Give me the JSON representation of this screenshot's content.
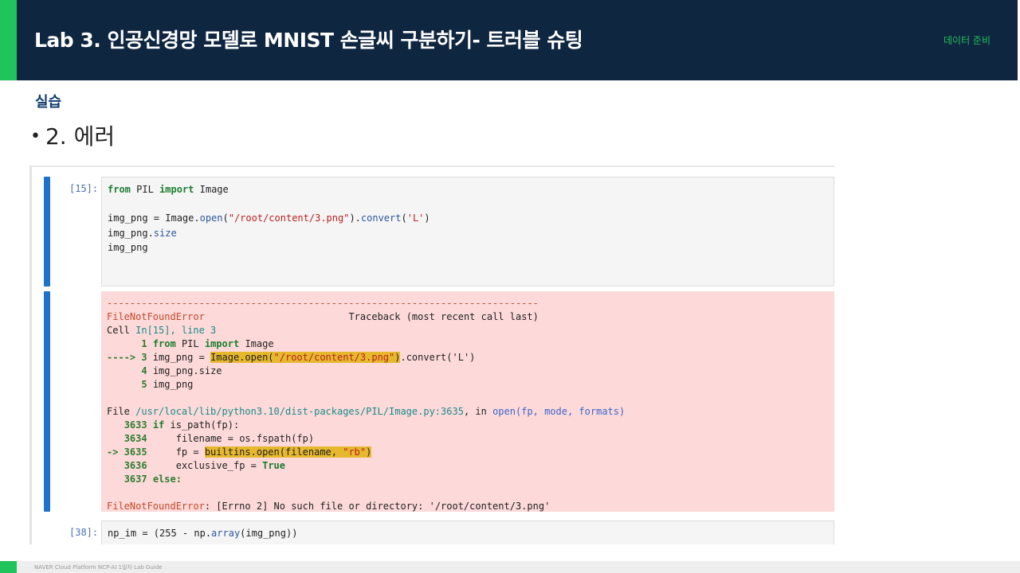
{
  "header": {
    "title": "Lab 3. 인공신경망 모델로 MNIST 손글씨 구분하기- 트러블 슈팅",
    "section": "데이터 준비",
    "colors": {
      "background": "#0f2640",
      "accent": "#1fc45a"
    }
  },
  "content": {
    "section_label": "실습",
    "bullet_marker": "•",
    "bullet_text": "2. 에러"
  },
  "notebook": {
    "cell1": {
      "prompt": "[15]:",
      "lines": [
        "from PIL import Image",
        "",
        "img_png = Image.open(\"/root/content/3.png\").convert('L')",
        "img_png.size",
        "img_png"
      ]
    },
    "error": {
      "dashes": "---------------------------------------------------------------------------",
      "error_name": "FileNotFoundError",
      "traceback_label": "Traceback (most recent call last)",
      "cell_ref_prefix": "Cell ",
      "cell_ref": "In[15], line 3",
      "tb_line1_num": "1",
      "tb_line1_code": "from PIL import Image",
      "tb_arrow": "----> 3 ",
      "tb_line3_pre": "img_png = ",
      "tb_line3_hl_fn": "Image.open(",
      "tb_line3_hl_str": "\"/root/content/3.png\"",
      "tb_line3_hl_close": ")",
      "tb_line3_post": ".convert('L')",
      "tb_line4_num": "4",
      "tb_line4_code": "img_png.size",
      "tb_line5_num": "5",
      "tb_line5_code": "img_png",
      "file_prefix": "File ",
      "file_path": "/usr/local/lib/python3.10/dist-packages/PIL/Image.py:3635",
      "file_in": ", in ",
      "file_func": "open(fp, mode, formats)",
      "l3633_num": "3633",
      "l3633_code": "if is_path(fp):",
      "l3634_num": "3634",
      "l3634_code": "filename = os.fspath(fp)",
      "l3635_arrow": "-> 3635",
      "l3635_pre": "fp = ",
      "l3635_hl_fn": "builtins.open(filename, ",
      "l3635_hl_str": "\"rb\"",
      "l3635_hl_close": ")",
      "l3636_num": "3636",
      "l3636_code": "exclusive_fp = True",
      "l3637_num": "3637",
      "l3637_code": "else:",
      "final_error": "FileNotFoundError",
      "final_message": ": [Errno 2] No such file or directory: '/root/content/3.png'"
    },
    "cell2": {
      "prompt": "[38]:",
      "line": "np_im = (255 - np.array(img_png))"
    }
  },
  "footer": {
    "text": "NAVER Cloud Platform  NCP-AI 1일차 Lab Guide"
  }
}
